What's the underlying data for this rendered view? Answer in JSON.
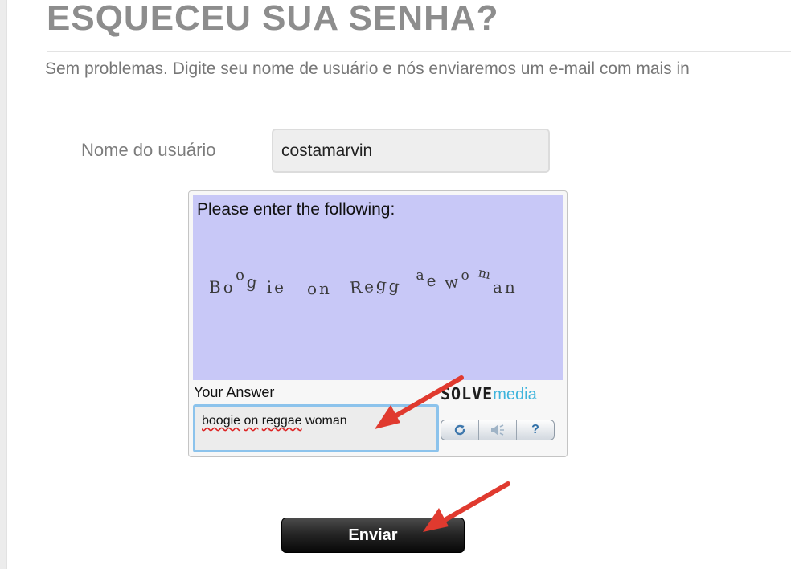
{
  "page": {
    "title": "ESQUECEU SUA SENHA?",
    "subtitle": "Sem problemas. Digite seu nome de usuário e nós enviaremos um e-mail com mais in"
  },
  "form": {
    "username_label": "Nome do usuário",
    "username_value": "costamarvin",
    "submit_label": "Enviar"
  },
  "captcha": {
    "prompt": "Please enter the following:",
    "challenge_text": "Boogie on Reggae woman",
    "answer_label": "Your Answer",
    "answer_prefix": "",
    "answer_words": [
      "boogie",
      "on",
      "reggae",
      "woman"
    ],
    "brand_solve": "SOLVE",
    "brand_media": "media",
    "controls": [
      {
        "name": "refresh",
        "icon": "refresh-icon"
      },
      {
        "name": "audio",
        "icon": "speaker-icon"
      },
      {
        "name": "help",
        "icon": "help-icon",
        "label": "?"
      }
    ]
  },
  "colors": {
    "captcha_bg": "#c8c8f7",
    "brand_media": "#3fb4dc",
    "annotation_arrow": "#e03a2f",
    "focus_border": "#8cc3ec"
  },
  "annotations": [
    "arrow-to-answer-input",
    "arrow-to-submit-button"
  ]
}
